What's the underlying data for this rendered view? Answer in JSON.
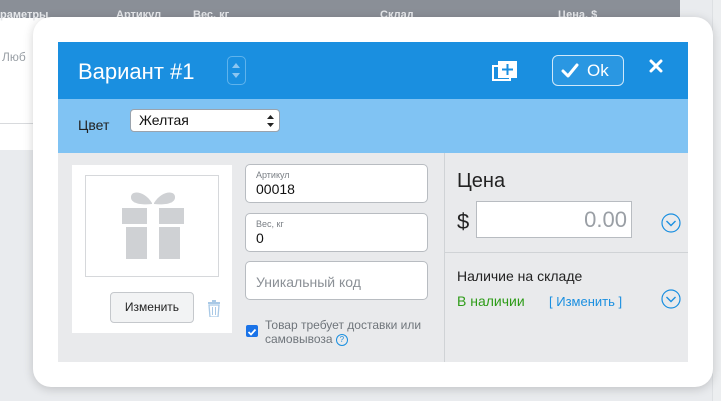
{
  "background": {
    "headers": [
      "раметры",
      "Артикул",
      "Вес, кг",
      "Склад",
      "Цена, $"
    ],
    "cell": "Люб"
  },
  "modal": {
    "title": "Вариант #1",
    "ok_label": "Ok",
    "color": {
      "label": "Цвет",
      "selected": "Желтая"
    },
    "image": {
      "change_label": "Изменить"
    },
    "fields": {
      "sku": {
        "label": "Артикул",
        "value": "00018"
      },
      "weight": {
        "label": "Вес, кг",
        "value": "0"
      },
      "unique_code": {
        "placeholder": "Уникальный код"
      }
    },
    "shipping_checkbox": {
      "checked": true,
      "label": "Товар требует доставки или самовывоза"
    },
    "price": {
      "title": "Цена",
      "currency": "$",
      "value": "0.00"
    },
    "stock": {
      "title": "Наличие на складе",
      "status": "В наличии",
      "change_link": "[ Изменить ]"
    },
    "colors": {
      "header_blue": "#1a8fe0",
      "color_bar": "#80c3f3",
      "in_stock_green": "#2e9c18"
    },
    "icons": [
      "spinner-icon",
      "duplicate-icon",
      "check-icon",
      "close-icon",
      "gift-icon",
      "trash-icon",
      "help-icon",
      "chevron-down-icon"
    ]
  }
}
